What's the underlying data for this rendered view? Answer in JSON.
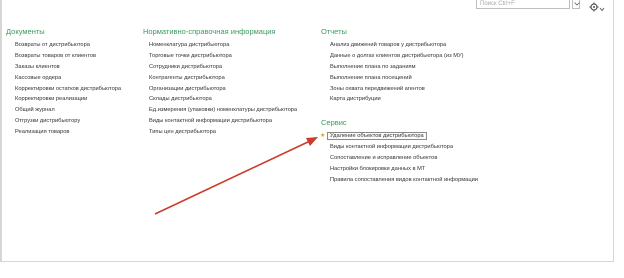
{
  "search": {
    "placeholder": "Поиск Ctrl+F"
  },
  "icons": {
    "settings": "gear-icon",
    "dropdown": "chevron-down-icon",
    "favorite": "star-icon"
  },
  "columns": {
    "documents": {
      "title": "Документы",
      "items": [
        "Возвраты от дистрибьютора",
        "Возвраты товаров от клиентов",
        "Заказы клиентов",
        "Кассовые ордера",
        "Корректировки остатков дистрибьютора",
        "Корректировки реализации",
        "Общий журнал",
        "Отгрузки дистрибьютору",
        "Реализация товаров"
      ]
    },
    "reference": {
      "title": "Нормативно-справочная информация",
      "items": [
        "Номенклатура дистрибьютора",
        "Торговые точки дистрибьютора",
        "Сотрудники дистрибьютора",
        "Контрагенты дистрибьютора",
        "Организации дистрибьютора",
        "Склады дистрибьютора",
        "Ед.измерения (упаковки)  номенклатуры дистрибьютора",
        "Виды контактной информации дистрибьютора",
        "Типы цен дистрибьютора"
      ]
    },
    "reports": {
      "title": "Отчеты",
      "items": [
        "Анализ движений товаров у дистрибьютора",
        "Данные о долгах клиентов дистрибьютора (из МУ)",
        "Выполнение плана по заданиям",
        "Выполнение плана посещений",
        "Зоны охвата передвижений агентов",
        "Карта дистрибуции"
      ]
    },
    "service": {
      "title": "Сервис",
      "items": [
        "Удаление объектов дистрибьютора",
        "Виды контактной информации дистрибьютора",
        "Сопоставление и исправление объектов",
        "Настройки блокировки данных в МТ",
        "Правила сопоставления видов контактной информации"
      ]
    }
  },
  "colors": {
    "section_title": "#3c9a5f",
    "arrow": "#cc3b2b",
    "link": "#333333",
    "favorite_star": "#f0a000"
  }
}
